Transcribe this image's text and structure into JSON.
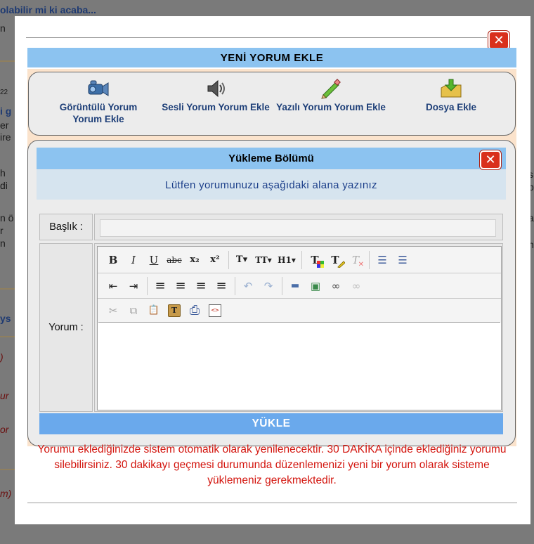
{
  "background": {
    "top_text": "olabilir mi ki acaba...",
    "fragments": [
      "n",
      "22",
      "i g",
      "er",
      "ire",
      "h",
      "di",
      "n ö",
      "r",
      "n",
      "ys",
      ")",
      "ur",
      "or",
      "m)",
      "s",
      "b",
      "a",
      "n"
    ]
  },
  "modal": {
    "title": "YENİ YORUM EKLE",
    "close_label": "✕",
    "tools": [
      {
        "label": "Görüntülü Yorum Yorum Ekle",
        "icon": "video-camera-icon"
      },
      {
        "label": "Sesli Yorum Yorum Ekle",
        "icon": "speaker-icon"
      },
      {
        "label": "Yazılı Yorum Yorum Ekle",
        "icon": "pencil-icon"
      },
      {
        "label": "Dosya Ekle",
        "icon": "download-folder-icon"
      }
    ],
    "upload": {
      "title": "Yükleme Bölümü",
      "instruction": "Lütfen yorumunuzu aşağıdaki alana yazınız",
      "title_label": "Başlık :",
      "title_value": "",
      "comment_label": "Yorum :",
      "submit_label": "YÜKLE"
    },
    "notice": "Yorumu eklediğinizde sistem otomatik olarak yenilenecektir. 30 DAKİKA içinde eklediğiniz yorumu silebilirsiniz. 30 dakikayı geçmesi durumunda düzenlemenizi yeni bir yorum olarak sisteme yüklemeniz gerekmektedir."
  },
  "toolbar": {
    "row1": [
      {
        "name": "bold-button",
        "glyph": "B"
      },
      {
        "name": "italic-button",
        "glyph": "I"
      },
      {
        "name": "underline-button",
        "glyph": "U"
      },
      {
        "name": "strikethrough-button",
        "glyph": "abc"
      },
      {
        "name": "subscript-button",
        "glyph": "x₂"
      },
      {
        "name": "superscript-button",
        "glyph": "x²"
      },
      {
        "name": "font-family-button",
        "glyph": "T▾"
      },
      {
        "name": "font-size-button",
        "glyph": "TT▾"
      },
      {
        "name": "heading-button",
        "glyph": "H1▾"
      },
      {
        "name": "text-color-button",
        "glyph": "T"
      },
      {
        "name": "highlight-button",
        "glyph": "T"
      },
      {
        "name": "clear-format-button",
        "glyph": "T"
      },
      {
        "name": "bullet-list-button",
        "glyph": "☰"
      },
      {
        "name": "numbered-list-button",
        "glyph": "☰"
      }
    ],
    "row2": [
      {
        "name": "outdent-button",
        "glyph": "⇤"
      },
      {
        "name": "indent-button",
        "glyph": "⇥"
      },
      {
        "name": "align-left-button",
        "glyph": "≡"
      },
      {
        "name": "align-center-button",
        "glyph": "≡"
      },
      {
        "name": "align-right-button",
        "glyph": "≡"
      },
      {
        "name": "justify-button",
        "glyph": "≡"
      },
      {
        "name": "undo-button",
        "glyph": "↶"
      },
      {
        "name": "redo-button",
        "glyph": "↷"
      },
      {
        "name": "horizontal-rule-button",
        "glyph": "▬"
      },
      {
        "name": "insert-image-button",
        "glyph": "▣"
      },
      {
        "name": "insert-link-button",
        "glyph": "∞"
      },
      {
        "name": "remove-link-button",
        "glyph": "∞"
      }
    ],
    "row3": [
      {
        "name": "cut-button",
        "glyph": "✂"
      },
      {
        "name": "copy-button",
        "glyph": "⧉"
      },
      {
        "name": "paste-button",
        "glyph": "📋"
      },
      {
        "name": "paste-text-button",
        "glyph": "T"
      },
      {
        "name": "print-button",
        "glyph": "⎙"
      },
      {
        "name": "source-button",
        "glyph": "<>"
      }
    ]
  },
  "colors": {
    "header_blue": "#8cc3f0",
    "button_blue": "#6aa9ec",
    "close_red": "#d9301c",
    "notice_red": "#d3150e",
    "link_blue": "#1e3f78"
  }
}
